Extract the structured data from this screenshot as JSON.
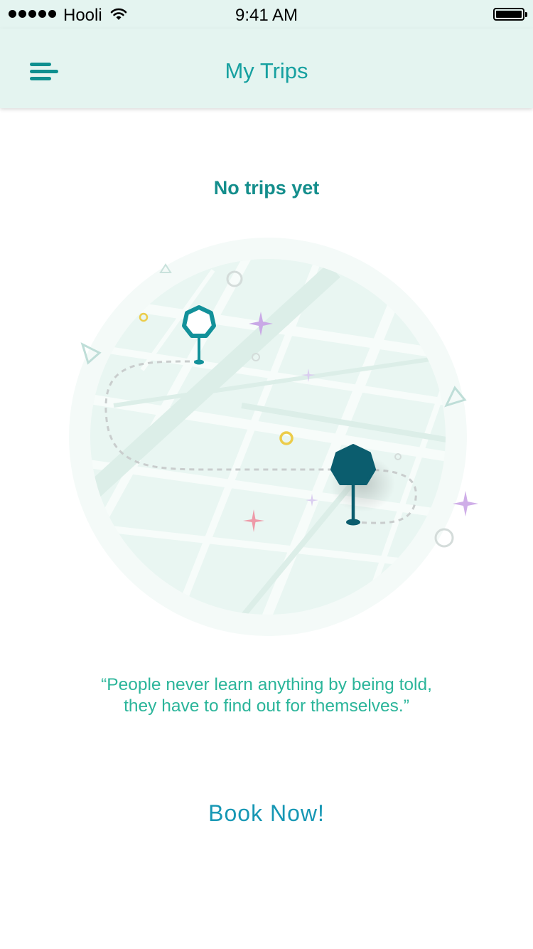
{
  "status_bar": {
    "carrier": "Hooli",
    "time": "9:41 AM"
  },
  "nav": {
    "title": "My Trips",
    "menu_icon": "hamburger-menu-icon"
  },
  "empty_state": {
    "title": "No trips yet",
    "quote": "“People never learn anything by being told, they have to find out for themselves.”",
    "illustration_icons": [
      "map-illustration",
      "start-pin-icon",
      "destination-pin-icon",
      "dashed-route"
    ]
  },
  "cta": {
    "book_now": "Book Now!"
  },
  "colors": {
    "header_background": "#e4f4f0",
    "accent": "#16a0a0",
    "title_color": "#148e8c",
    "quote_color": "#2bb59a",
    "cta_color": "#1697b4",
    "pin_dark": "#0b5d6e",
    "pin_light": "#12919a"
  }
}
